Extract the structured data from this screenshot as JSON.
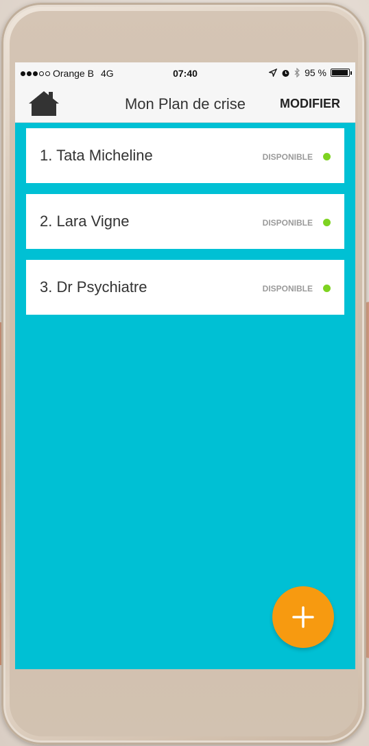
{
  "status_bar": {
    "carrier": "Orange B",
    "network": "4G",
    "time": "07:40",
    "battery": "95 %",
    "battery_level": 0.95
  },
  "nav": {
    "title": "Mon Plan de crise",
    "edit_label": "MODIFIER",
    "home_icon": "home-icon"
  },
  "contacts": [
    {
      "name": "1. Tata Micheline",
      "status": "DISPONIBLE"
    },
    {
      "name": "2. Lara Vigne",
      "status": "DISPONIBLE"
    },
    {
      "name": "3. Dr Psychiatre",
      "status": "DISPONIBLE"
    }
  ],
  "fab": {
    "icon": "plus-icon"
  },
  "colors": {
    "background": "#00c0d4",
    "available": "#7ed321",
    "fab": "#f79a10"
  }
}
